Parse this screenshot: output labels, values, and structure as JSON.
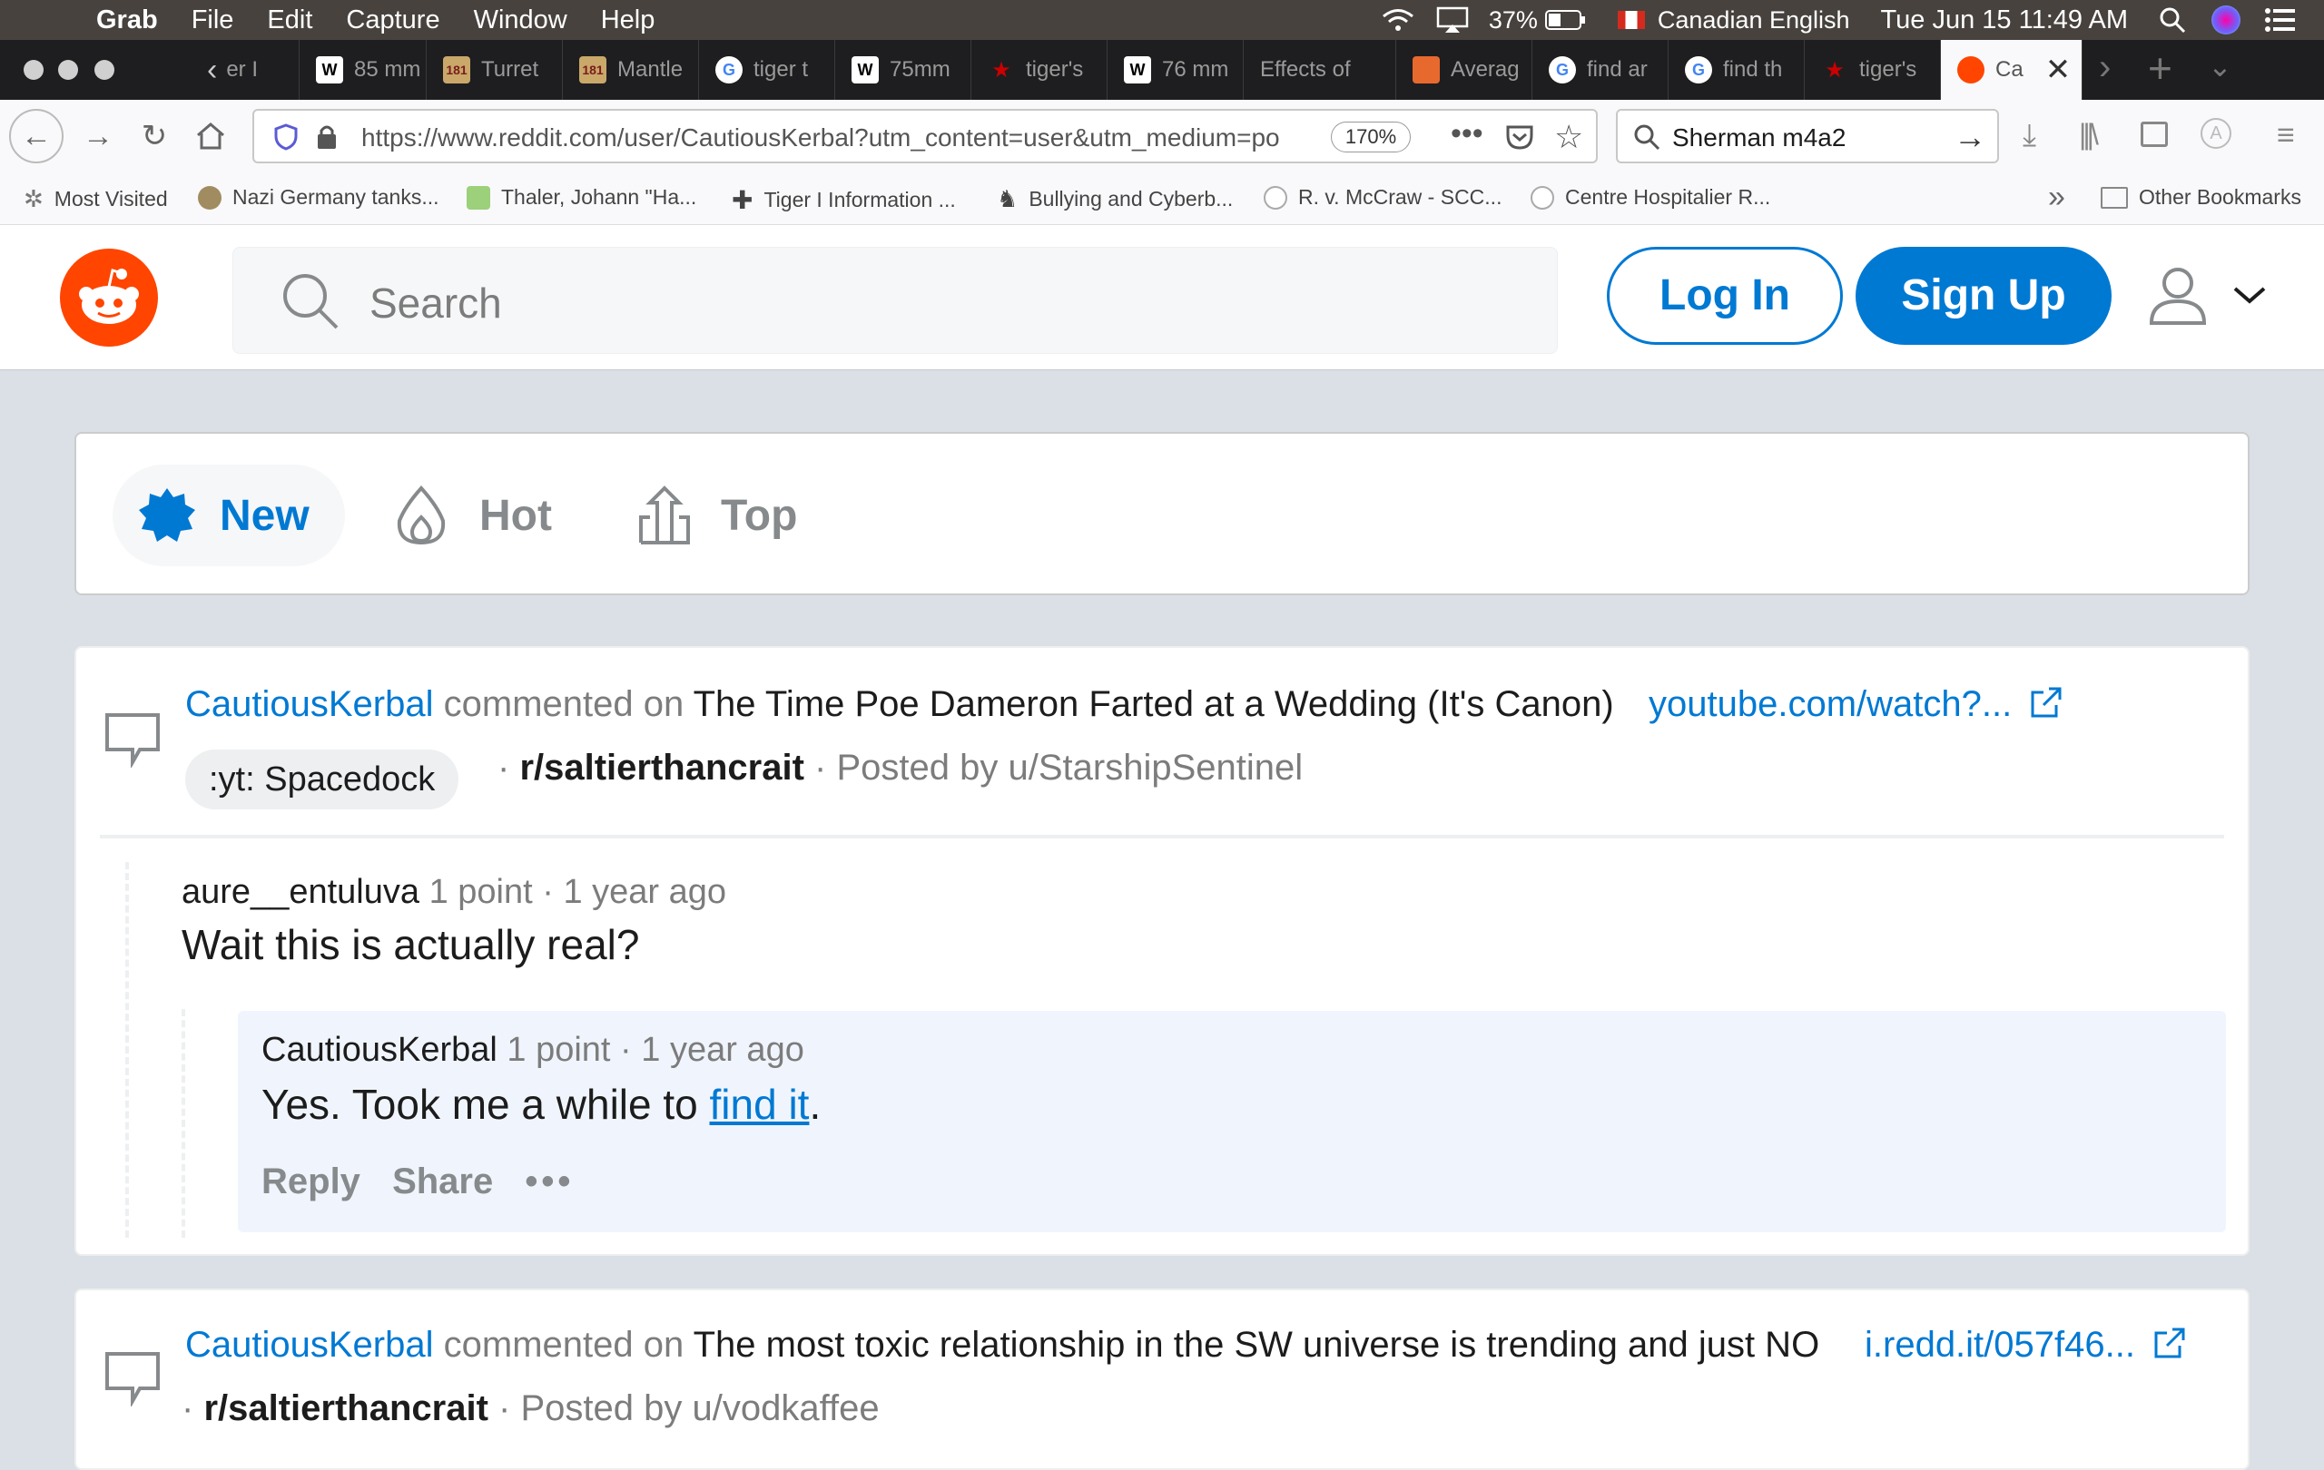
{
  "menubar": {
    "app": "Grab",
    "items": [
      "File",
      "Edit",
      "Capture",
      "Window",
      "Help"
    ],
    "battery": "37%",
    "input_source": "Canadian English",
    "datetime": "Tue Jun 15  11:49 AM"
  },
  "tabs": [
    {
      "label": "er I",
      "icon": ""
    },
    {
      "label": "85 mm",
      "icon": "W"
    },
    {
      "label": "Turret",
      "icon": "181"
    },
    {
      "label": "Mantle",
      "icon": "181"
    },
    {
      "label": "tiger t",
      "icon": "G"
    },
    {
      "label": "75mm",
      "icon": "W"
    },
    {
      "label": "tiger's",
      "icon": "★"
    },
    {
      "label": "76 mm",
      "icon": "W"
    },
    {
      "label": "Effects of",
      "icon": ""
    },
    {
      "label": "Averag",
      "icon": ""
    },
    {
      "label": "find ar",
      "icon": "G"
    },
    {
      "label": "find th",
      "icon": "G"
    },
    {
      "label": "tiger's",
      "icon": "★"
    },
    {
      "label": "Ca",
      "icon": "reddit"
    }
  ],
  "navbar": {
    "url": "https://www.reddit.com/user/CautiousKerbal?utm_content=user&utm_medium=po",
    "zoom": "170%",
    "search_value": "Sherman m4a2"
  },
  "bookmarks": [
    "Most Visited",
    "Nazi Germany tanks...",
    "Thaler, Johann \"Ha...",
    "Tiger I Information ...",
    "Bullying and Cyberb...",
    "R. v. McCraw - SCC...",
    "Centre Hospitalier R...",
    "Other Bookmarks"
  ],
  "reddit": {
    "search_placeholder": "Search",
    "login": "Log In",
    "signup": "Sign Up"
  },
  "sort": {
    "new": "New",
    "hot": "Hot",
    "top": "Top"
  },
  "posts": [
    {
      "author": "CautiousKerbal",
      "action": "commented on",
      "title": "The Time Poe Dameron Farted at a Wedding (It's Canon)",
      "link": "youtube.com/watch?...",
      "flair": ":yt: Spacedock",
      "subreddit": "r/saltierthancrait",
      "posted_by": "Posted by u/StarshipSentinel",
      "comment": {
        "user": "aure__entuluva",
        "points": "1 point",
        "age": "1 year ago",
        "body": "Wait this is actually real?"
      },
      "reply": {
        "user": "CautiousKerbal",
        "points": "1 point",
        "age": "1 year ago",
        "body_prefix": "Yes. Took me a while to ",
        "body_link": "find it",
        "body_suffix": ".",
        "reply_label": "Reply",
        "share_label": "Share",
        "more": "•••"
      }
    },
    {
      "author": "CautiousKerbal",
      "action": "commented on",
      "title": "The most toxic relationship in the SW universe is trending and just NO",
      "link": "i.redd.it/057f46...",
      "subreddit": "r/saltierthancrait",
      "posted_by": "Posted by u/vodkaffee"
    }
  ],
  "colors": {
    "reddit_orange": "#ff4500",
    "reddit_blue": "#0079d3",
    "page_bg": "#dae0e6"
  }
}
